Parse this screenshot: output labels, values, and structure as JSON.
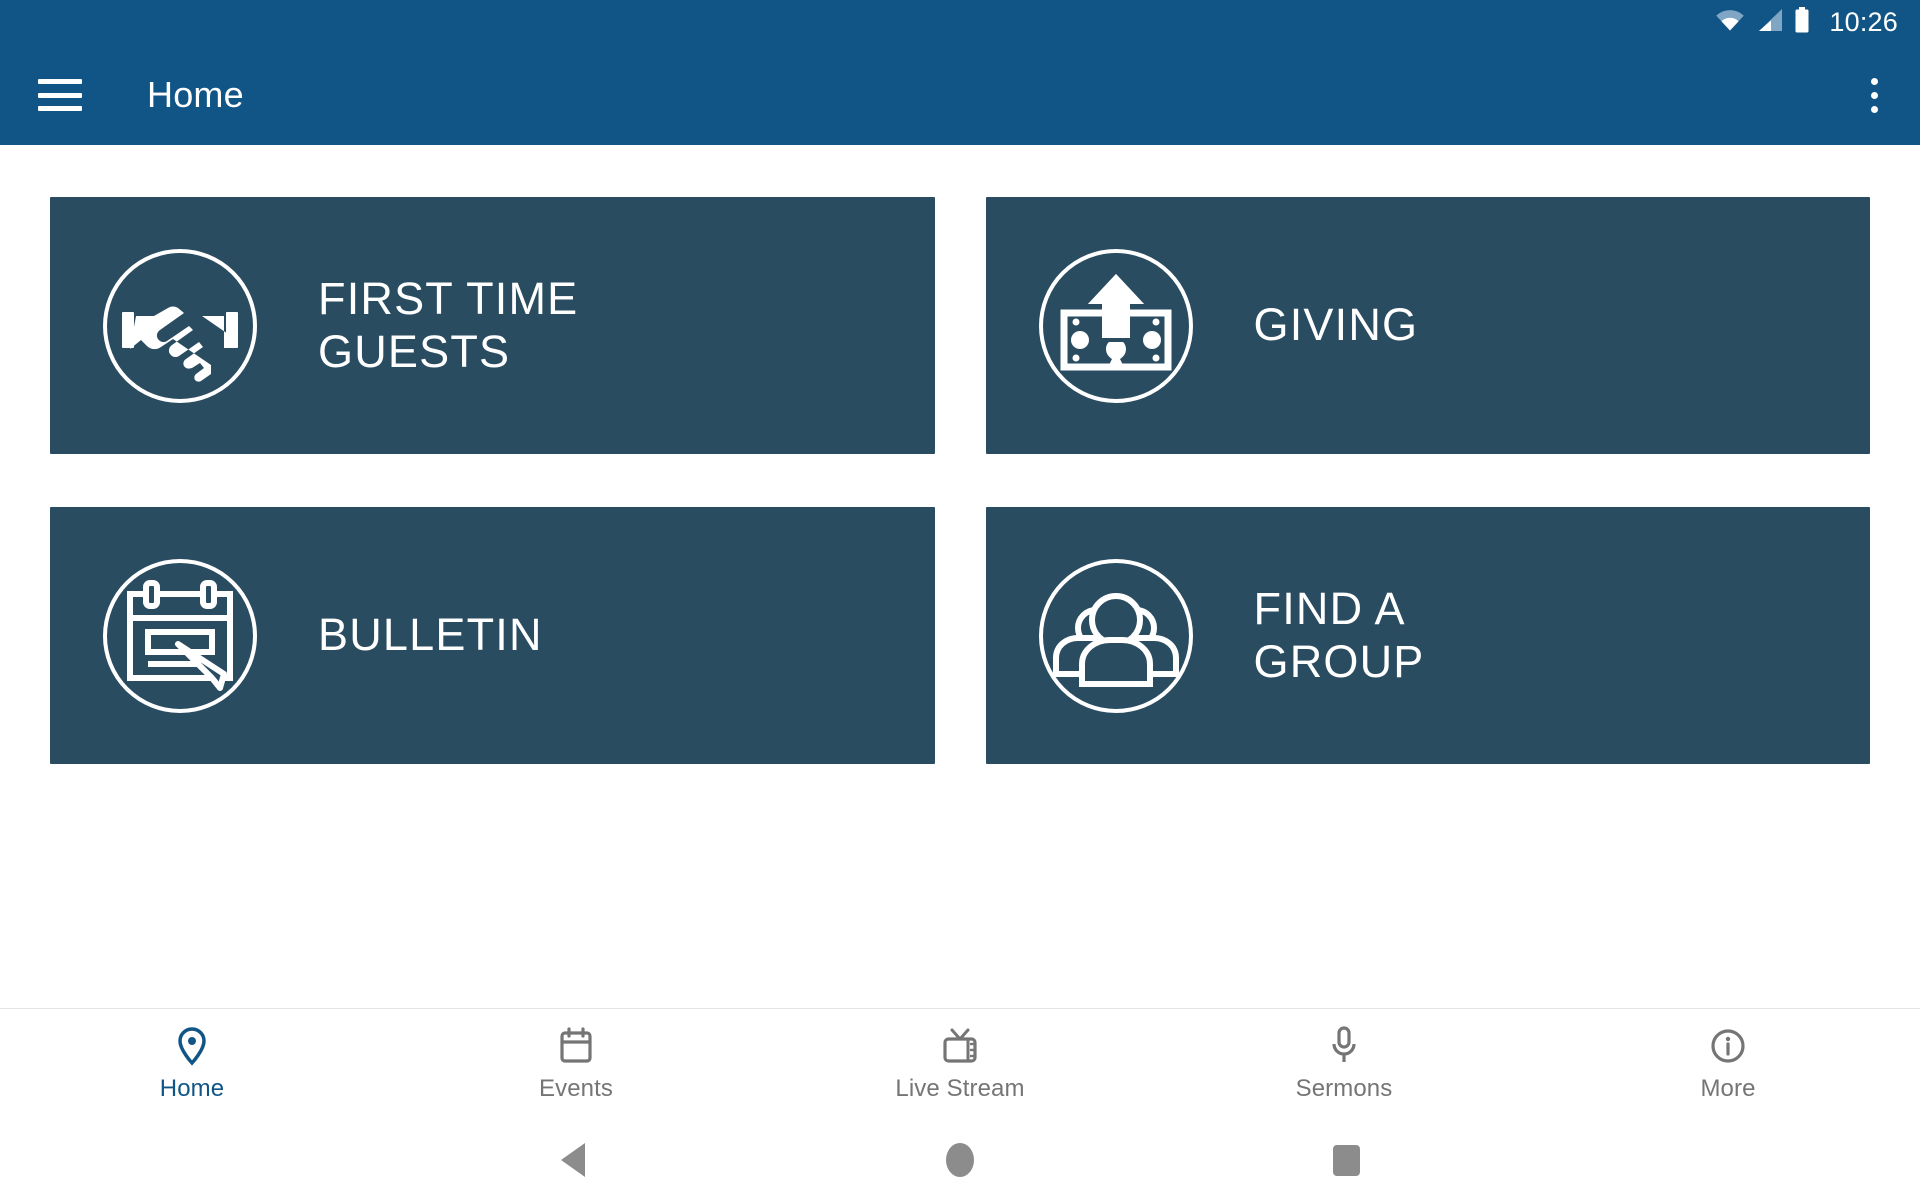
{
  "status_bar": {
    "time": "10:26",
    "icons": [
      "wifi-icon",
      "cellular-signal-icon",
      "battery-icon"
    ]
  },
  "app_bar": {
    "menu_icon": "hamburger-menu-icon",
    "title": "Home",
    "overflow_icon": "overflow-menu-icon",
    "background_color": "#115586"
  },
  "theme": {
    "primary": "#115586",
    "tile_background": "#2a4c61",
    "tile_text": "#ffffff",
    "tab_inactive": "#757575",
    "tab_active": "#115586"
  },
  "main": {
    "tiles": [
      {
        "label": "First Time\nGuests",
        "icon": "handshake-icon"
      },
      {
        "label": "Giving",
        "icon": "money-arrow-up-icon"
      },
      {
        "label": "Bulletin",
        "icon": "calendar-pencil-icon"
      },
      {
        "label": "Find A\nGroup",
        "icon": "group-people-icon"
      }
    ]
  },
  "tab_bar": {
    "items": [
      {
        "label": "Home",
        "icon": "location-pin-icon",
        "active": true
      },
      {
        "label": "Events",
        "icon": "calendar-icon",
        "active": false
      },
      {
        "label": "Live Stream",
        "icon": "television-icon",
        "active": false
      },
      {
        "label": "Sermons",
        "icon": "microphone-icon",
        "active": false
      },
      {
        "label": "More",
        "icon": "info-circle-icon",
        "active": false
      }
    ]
  },
  "system_nav": {
    "back": "back-triangle-icon",
    "home": "home-circle-icon",
    "recents": "recents-square-icon"
  }
}
